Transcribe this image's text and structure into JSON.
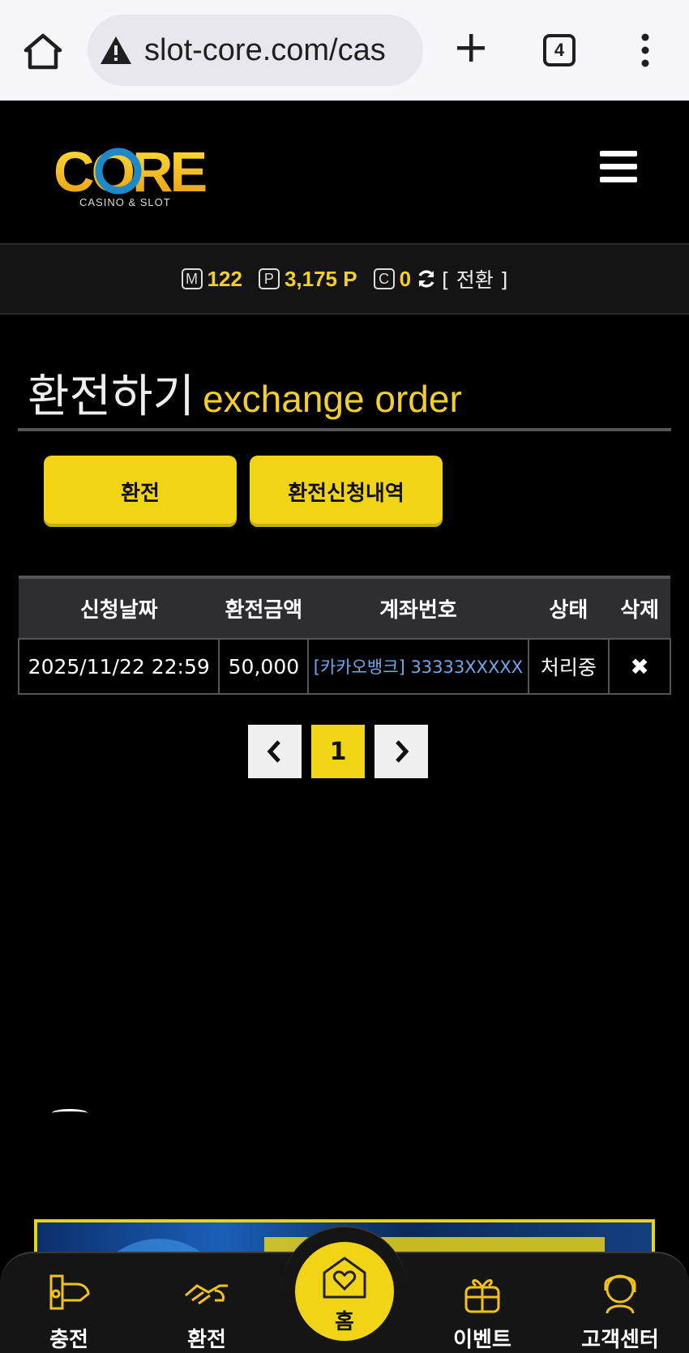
{
  "browser": {
    "url": "slot-core.com/cas",
    "tab_count": "4"
  },
  "header": {
    "logo_text": "CORE",
    "logo_sub": "CASINO & SLOT"
  },
  "balance": {
    "money_icon": "M",
    "money": "122",
    "point_icon": "P",
    "point": "3,175 P",
    "coin_icon": "C",
    "coin": "0",
    "convert_label": "[ 전환 ]"
  },
  "page": {
    "title_ko": "환전하기",
    "title_en": "exchange order"
  },
  "tabs": {
    "exchange": "환전",
    "history": "환전신청내역"
  },
  "table": {
    "headers": [
      "신청날짜",
      "환전금액",
      "계좌번호",
      "상태",
      "삭제"
    ],
    "rows": [
      {
        "date": "2025/11/22 22:59",
        "amount": "50,000",
        "account": "[카카오뱅크] 33333XXXXX",
        "status": "처리중",
        "delete": "✖"
      }
    ]
  },
  "pagination": {
    "prev": "‹",
    "current": "1",
    "next": "›"
  },
  "bottom_nav": {
    "charge": "충전",
    "exchange": "환전",
    "home": "홈",
    "event": "이벤트",
    "support": "고객센터"
  },
  "colors": {
    "accent": "#f2d417",
    "background": "#000000",
    "link": "#6fa8f0"
  }
}
